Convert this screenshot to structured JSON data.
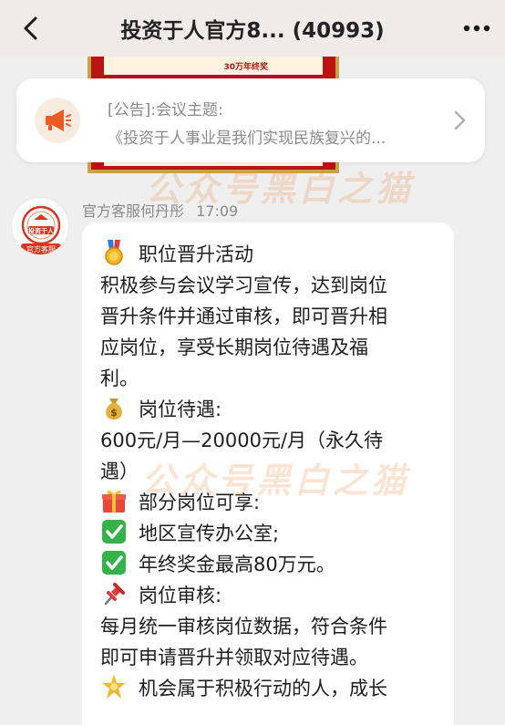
{
  "header": {
    "title": "投资于人官方8... (40993)",
    "back_icon": "chevron-left-icon",
    "more_icon": "more-dots-icon",
    "background": "#f1eaea"
  },
  "poster": {
    "award_text": "30万年终奖"
  },
  "notice": {
    "line1": "[公告]:会议主题:",
    "line2": "《投资于人事业是我们实现民族复兴的...",
    "icon": "megaphone-icon",
    "accent": "#ee5a24"
  },
  "message": {
    "sender": "官方客服何丹彤",
    "time": "17:09",
    "avatar_text_top": "投资于人",
    "avatar_text_bottom": "官方客服",
    "lines": [
      {
        "emoji": "medal",
        "text": "职位晋升活动"
      },
      {
        "emoji": "",
        "text": "积极参与会议学习宣传，达到岗位"
      },
      {
        "emoji": "",
        "text": "晋升条件并通过审核，即可晋升相"
      },
      {
        "emoji": "",
        "text": "应岗位，享受长期岗位待遇及福"
      },
      {
        "emoji": "",
        "text": "利。"
      },
      {
        "emoji": "money-bag",
        "text": "岗位待遇:"
      },
      {
        "emoji": "",
        "text": "600元/月—20000元/月（永久待"
      },
      {
        "emoji": "",
        "text": "遇）"
      },
      {
        "emoji": "gift",
        "text": "部分岗位可享:"
      },
      {
        "emoji": "check",
        "text": "地区宣传办公室;"
      },
      {
        "emoji": "check",
        "text": "年终奖金最高80万元。"
      },
      {
        "emoji": "pushpin",
        "text": "岗位审核:"
      },
      {
        "emoji": "",
        "text": "每月统一审核岗位数据，符合条件"
      },
      {
        "emoji": "",
        "text": "即可申请晋升并领取对应待遇。"
      },
      {
        "emoji": "star",
        "text": "机会属于积极行动的人，成长"
      }
    ]
  },
  "watermark": {
    "text": "公众号黑白之猫"
  }
}
